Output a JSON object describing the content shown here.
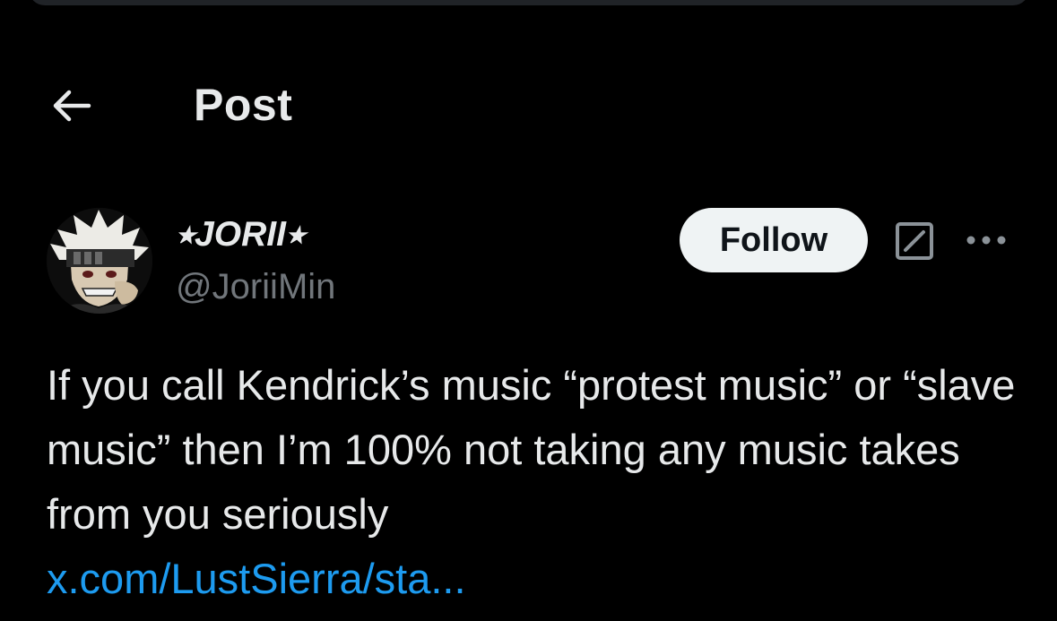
{
  "header": {
    "title": "Post",
    "back_icon": "arrow-left-icon"
  },
  "author": {
    "display_name": "⭑JORII⭑",
    "handle": "@JoriiMin",
    "avatar_icon": "user-avatar"
  },
  "actions": {
    "follow_label": "Follow",
    "grok_icon": "grok-icon",
    "more_icon": "more-options-icon"
  },
  "post": {
    "text": "If you call Kendrick’s music “protest music” or “slave music” then I’m 100% not taking any music takes from you seriously",
    "link": "x.com/LustSierra/sta..."
  },
  "colors": {
    "background": "#000000",
    "text_primary": "#e7e9ea",
    "text_secondary": "#71767b",
    "link": "#1d9bf0",
    "follow_bg": "#eff3f4",
    "follow_text": "#0f1419"
  }
}
